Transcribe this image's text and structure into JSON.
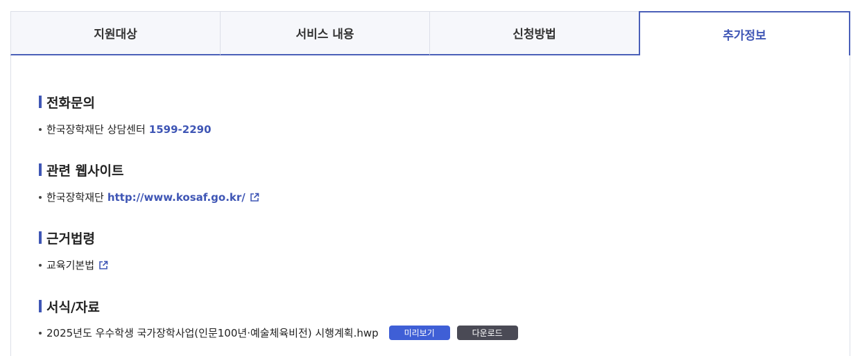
{
  "tabs": [
    "지원대상",
    "서비스 내용",
    "신청방법",
    "추가정보"
  ],
  "active_tab_index": 3,
  "accent_color": "#3f56b5",
  "sections": {
    "phone": {
      "title": "전화문의",
      "text": "한국장학재단 상담센터",
      "highlight": "1599-2290"
    },
    "website": {
      "title": "관련 웹사이트",
      "text": "한국장학재단",
      "link": "http://www.kosaf.go.kr/",
      "icon": "external-link-icon"
    },
    "law": {
      "title": "근거법령",
      "text": "교육기본법",
      "icon": "external-link-icon"
    },
    "forms": {
      "title": "서식/자료",
      "file": "2025년도 우수학생 국가장학사업(인문100년·예술체육비전) 시행계획.hwp",
      "preview_label": "미리보기",
      "download_label": "다운로드"
    }
  }
}
